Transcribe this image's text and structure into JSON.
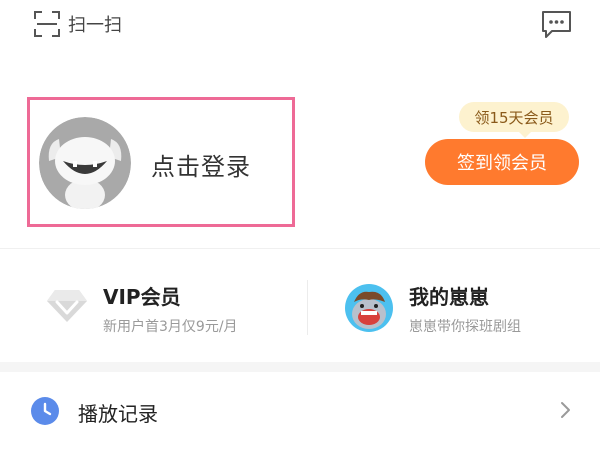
{
  "topbar": {
    "scan_label": "扫一扫"
  },
  "login": {
    "prompt": "点击登录"
  },
  "promo": {
    "tag": "领15天会员",
    "button": "签到领会员"
  },
  "features": {
    "vip": {
      "title": "VIP会员",
      "subtitle": "新用户首3月仅9元/月"
    },
    "mine": {
      "title": "我的崽崽",
      "subtitle": "崽崽带你探班剧组"
    }
  },
  "history": {
    "label": "播放记录"
  },
  "colors": {
    "highlight_border": "#ee6a96",
    "signin_orange": "#ff7a2e",
    "vip_tag_bg": "#fdf2cf",
    "clock_blue": "#5b8bea"
  },
  "icons": [
    "scan-icon",
    "message-icon",
    "robot-avatar-icon",
    "diamond-vip-icon",
    "mascot-avatar-icon",
    "clock-icon",
    "chevron-right-icon"
  ]
}
